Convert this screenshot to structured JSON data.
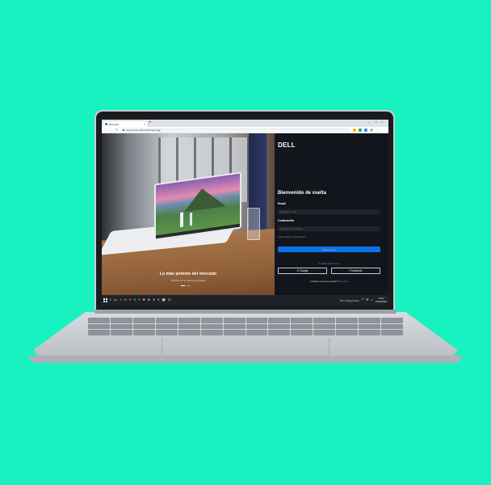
{
  "browser": {
    "tab_title": "Ecomsof",
    "url": "ecommerce.dell.cl/dell-login.app",
    "new_tab": "+",
    "close_tab": "×",
    "window_controls": [
      "–",
      "□",
      "×"
    ]
  },
  "nav": {
    "back_icon": "←",
    "forward_icon": "→",
    "reload_icon": "↻",
    "lock_icon": "lock-icon",
    "menu_icon": "⋮"
  },
  "hero": {
    "title": "Lo más potente del mercado",
    "subtitle": "Disfruta de la máxima velocidad"
  },
  "login": {
    "logo": "DELL",
    "title": "Bienvenido de vuelta",
    "email_label": "Email",
    "email_placeholder": "Ingresa tu email",
    "password_label": "Contraseña",
    "password_placeholder": "Ingresa tu contraseña",
    "forgot_password": "¿Has olvidado tu contraseña?",
    "login_button": "Iniciar sesión",
    "social_divider": "O inicia sesión con",
    "google_label": "Google",
    "facebook_label": "Facebook",
    "signup_prompt": "¿Todavía no tienes cuenta?",
    "signup_link": "Regístrate"
  },
  "taskbar": {
    "weather": "16°C Mayormente",
    "time": "18:42",
    "date": "12/02/2024"
  },
  "colors": {
    "background": "#17f2c0",
    "primary_button": "#0b72e7",
    "panel": "#12161c",
    "link": "#1d8bff"
  }
}
